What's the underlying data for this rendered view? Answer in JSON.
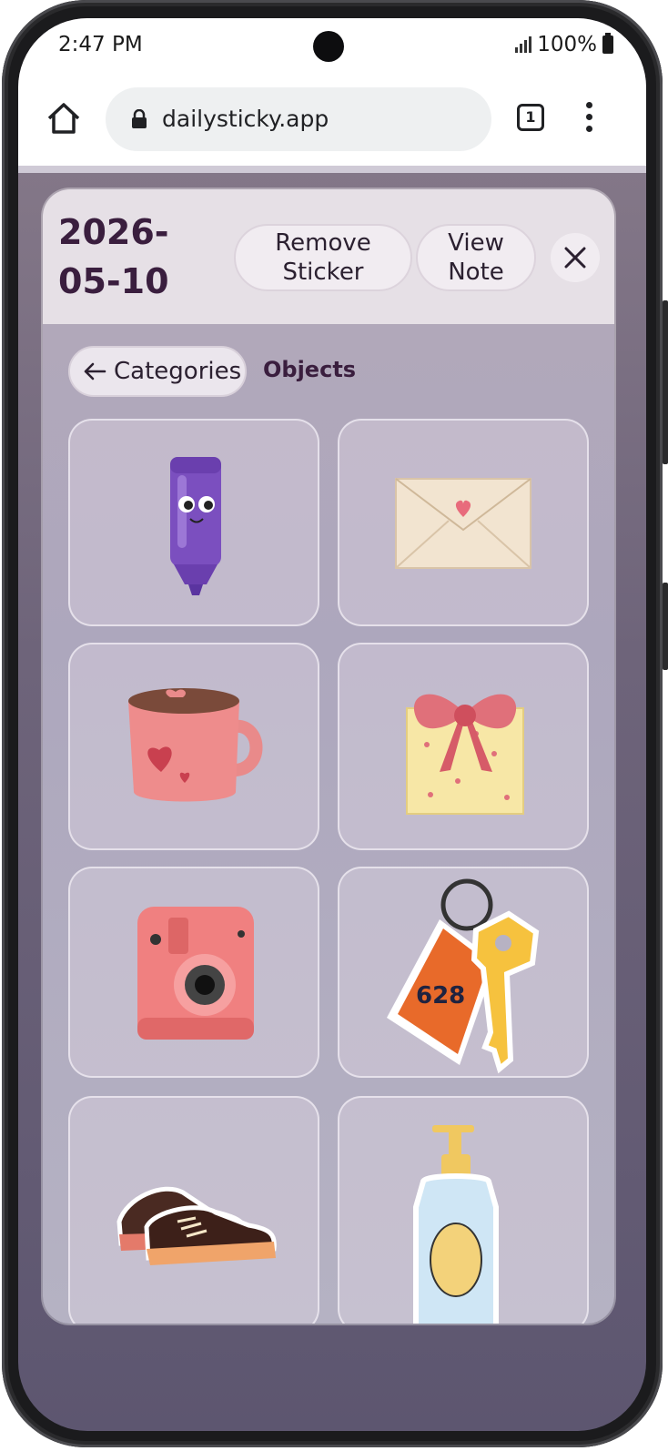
{
  "status_bar": {
    "time": "2:47 PM",
    "battery": "100%"
  },
  "browser": {
    "url": "dailysticky.app",
    "tab_count": "1"
  },
  "modal": {
    "date": "2026-05-10",
    "remove_sticker_label": "Remove Sticker",
    "view_note_label": "View Note",
    "categories_label": "Categories",
    "section_label": "Objects"
  },
  "stickers": [
    {
      "name": "purple-highlighter-sticker"
    },
    {
      "name": "love-envelope-sticker"
    },
    {
      "name": "heart-mug-sticker"
    },
    {
      "name": "gift-box-sticker"
    },
    {
      "name": "pink-camera-sticker"
    },
    {
      "name": "hotel-key-sticker",
      "tag_text": "628"
    },
    {
      "name": "sneakers-sticker"
    },
    {
      "name": "lotion-bottle-sticker"
    }
  ],
  "icons": {
    "home": "home-icon",
    "lock": "lock-icon",
    "tabs": "tabs-icon",
    "menu": "more-vert-icon",
    "close": "close-icon",
    "back": "arrow-left-icon"
  }
}
